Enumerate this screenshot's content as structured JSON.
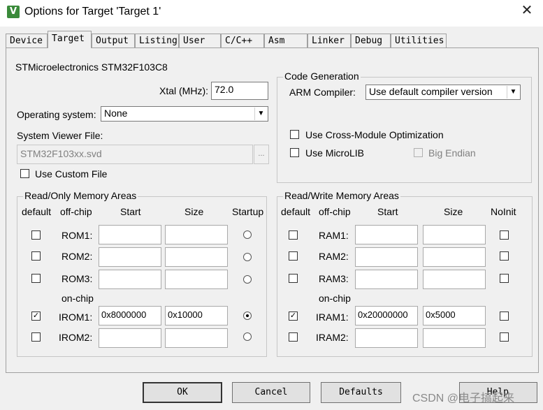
{
  "window": {
    "title": "Options for Target 'Target 1'",
    "close_glyph": "✕",
    "app_icon_glyph": "V"
  },
  "tabs": [
    {
      "label": "Device"
    },
    {
      "label": "Target"
    },
    {
      "label": "Output"
    },
    {
      "label": "Listing"
    },
    {
      "label": "User"
    },
    {
      "label": "C/C++"
    },
    {
      "label": "Asm"
    },
    {
      "label": "Linker"
    },
    {
      "label": "Debug"
    },
    {
      "label": "Utilities"
    }
  ],
  "active_tab": "Target",
  "device_name": "STMicroelectronics STM32F103C8",
  "xtal": {
    "label": "Xtal (MHz):",
    "value": "72.0"
  },
  "os": {
    "label": "Operating system:",
    "value": "None"
  },
  "svd": {
    "label": "System Viewer File:",
    "value": "STM32F103xx.svd",
    "browse": "..."
  },
  "custom_file": {
    "label": "Use Custom File",
    "checked": false
  },
  "code_gen": {
    "title": "Code Generation",
    "compiler_label": "ARM Compiler:",
    "compiler_value": "Use default compiler version",
    "cross_module": {
      "label": "Use Cross-Module Optimization",
      "checked": false
    },
    "microlib": {
      "label": "Use MicroLIB",
      "checked": false
    },
    "big_endian": {
      "label": "Big Endian",
      "checked": false,
      "disabled": true
    }
  },
  "rom": {
    "title": "Read/Only Memory Areas",
    "headers": {
      "default": "default",
      "offchip": "off-chip",
      "start": "Start",
      "size": "Size",
      "startup": "Startup"
    },
    "onchip_label": "on-chip",
    "rows": [
      {
        "name": "ROM1:",
        "default": false,
        "start": "",
        "size": "",
        "startup": false
      },
      {
        "name": "ROM2:",
        "default": false,
        "start": "",
        "size": "",
        "startup": false
      },
      {
        "name": "ROM3:",
        "default": false,
        "start": "",
        "size": "",
        "startup": false
      },
      {
        "name": "IROM1:",
        "default": true,
        "start": "0x8000000",
        "size": "0x10000",
        "startup": true
      },
      {
        "name": "IROM2:",
        "default": false,
        "start": "",
        "size": "",
        "startup": false
      }
    ]
  },
  "ram": {
    "title": "Read/Write Memory Areas",
    "headers": {
      "default": "default",
      "offchip": "off-chip",
      "start": "Start",
      "size": "Size",
      "noinit": "NoInit"
    },
    "onchip_label": "on-chip",
    "rows": [
      {
        "name": "RAM1:",
        "default": false,
        "start": "",
        "size": "",
        "noinit": false
      },
      {
        "name": "RAM2:",
        "default": false,
        "start": "",
        "size": "",
        "noinit": false
      },
      {
        "name": "RAM3:",
        "default": false,
        "start": "",
        "size": "",
        "noinit": false
      },
      {
        "name": "IRAM1:",
        "default": true,
        "start": "0x20000000",
        "size": "0x5000",
        "noinit": false
      },
      {
        "name": "IRAM2:",
        "default": false,
        "start": "",
        "size": "",
        "noinit": false
      }
    ]
  },
  "buttons": {
    "ok": "OK",
    "cancel": "Cancel",
    "defaults": "Defaults",
    "help": "Help"
  },
  "watermark": "CSDN @电子搞起来"
}
